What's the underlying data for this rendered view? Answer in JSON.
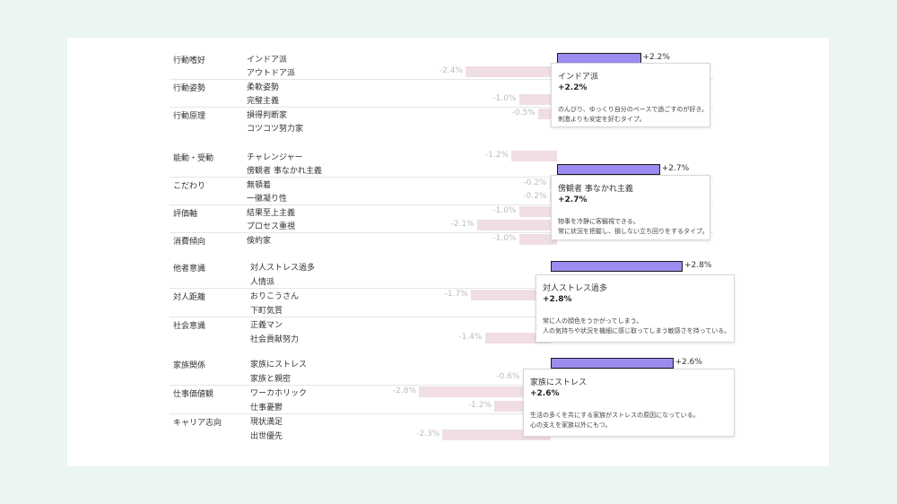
{
  "colors": {
    "positive": "#9b8cf0",
    "negative": "#f0dde6",
    "tooltip_border": "#d8d8d8"
  },
  "chart_data": [
    {
      "type": "bar",
      "orientation": "horizontal-diverging",
      "rows": [
        {
          "group": "行動嗜好",
          "label": "インドア派",
          "value": 2.2,
          "value_label": "+2.2%"
        },
        {
          "group": "",
          "label": "アウトドア派",
          "value": -2.4,
          "value_label": "-2.4%"
        },
        {
          "group": "行動姿勢",
          "label": "柔軟姿勢",
          "value": null,
          "value_label": ""
        },
        {
          "group": "",
          "label": "完璧主義",
          "value": -1.0,
          "value_label": "-1.0%"
        },
        {
          "group": "行動原理",
          "label": "損得判断家",
          "value": -0.5,
          "value_label": "-0.5%"
        },
        {
          "group": "",
          "label": "コツコツ努力家",
          "value": null,
          "value_label": ""
        }
      ],
      "tooltip": {
        "title": "インドア派",
        "value": "+2.2%",
        "desc": [
          "のんびり、ゆっくり自分のペースで過ごすのが好き。",
          "刺激よりも安定を好むタイプ。"
        ]
      }
    },
    {
      "type": "bar",
      "orientation": "horizontal-diverging",
      "rows": [
        {
          "group": "能動・受動",
          "label": "チャレンジャー",
          "value": -1.2,
          "value_label": "-1.2%"
        },
        {
          "group": "",
          "label": "傍観者 事なかれ主義",
          "value": 2.7,
          "value_label": "+2.7%"
        },
        {
          "group": "こだわり",
          "label": "無頓着",
          "value": -0.2,
          "value_label": "-0.2%"
        },
        {
          "group": "",
          "label": "一徹凝り性",
          "value": -0.2,
          "value_label": "-0.2%"
        },
        {
          "group": "評価軸",
          "label": "結果至上主義",
          "value": -1.0,
          "value_label": "-1.0%"
        },
        {
          "group": "",
          "label": "プロセス重視",
          "value": -2.1,
          "value_label": "-2.1%"
        },
        {
          "group": "消費傾向",
          "label": "倹約家",
          "value": -1.0,
          "value_label": "-1.0%"
        }
      ],
      "tooltip": {
        "title": "傍観者 事なかれ主義",
        "value": "+2.7%",
        "desc": [
          "物事を冷静に客観視できる。",
          "常に状況を把握し、損しない立ち回りをするタイプ。"
        ]
      }
    },
    {
      "type": "bar",
      "orientation": "horizontal-diverging",
      "rows": [
        {
          "group": "他者意識",
          "label": "対人ストレス過多",
          "value": 2.8,
          "value_label": "+2.8%"
        },
        {
          "group": "",
          "label": "人情派",
          "value": null,
          "value_label": ""
        },
        {
          "group": "対人距離",
          "label": "おりこうさん",
          "value": -1.7,
          "value_label": "-1.7%"
        },
        {
          "group": "",
          "label": "下町気質",
          "value": null,
          "value_label": ""
        },
        {
          "group": "社会意識",
          "label": "正義マン",
          "value": null,
          "value_label": ""
        },
        {
          "group": "",
          "label": "社会貢献努力",
          "value": -1.4,
          "value_label": "-1.4%"
        }
      ],
      "tooltip": {
        "title": "対人ストレス過多",
        "value": "+2.8%",
        "desc": [
          "常に人の顔色をうかがってしまう。",
          "人の気持ちや状況を機細に感じ取ってしまう敏感さを持っている。"
        ]
      }
    },
    {
      "type": "bar",
      "orientation": "horizontal-diverging",
      "rows": [
        {
          "group": "家族関係",
          "label": "家族にストレス",
          "value": 2.6,
          "value_label": "+2.6%"
        },
        {
          "group": "",
          "label": "家族と親密",
          "value": -0.6,
          "value_label": "-0.6%"
        },
        {
          "group": "仕事価値観",
          "label": "ワーカホリック",
          "value": -2.8,
          "value_label": "-2.8%"
        },
        {
          "group": "",
          "label": "仕事憂鬱",
          "value": -1.2,
          "value_label": "-1.2%"
        },
        {
          "group": "キャリア志向",
          "label": "現状満足",
          "value": null,
          "value_label": ""
        },
        {
          "group": "",
          "label": "出世優先",
          "value": -2.3,
          "value_label": "-2.3%"
        }
      ],
      "tooltip": {
        "title": "家族にストレス",
        "value": "+2.6%",
        "desc": [
          "生活の多くを共にする家族がストレスの原因になっている。",
          "心の支えを家族以外にもつ。"
        ]
      }
    }
  ]
}
